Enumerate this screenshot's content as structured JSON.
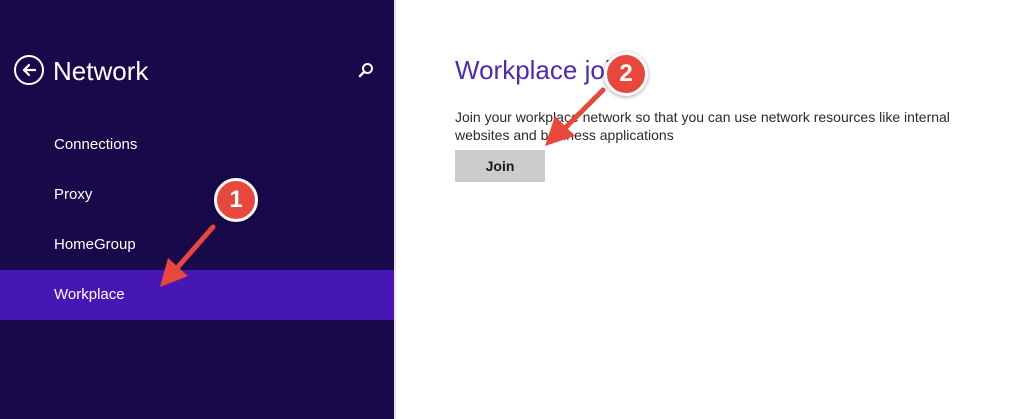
{
  "sidebar": {
    "title": "Network",
    "items": [
      {
        "label": "Connections",
        "selected": false
      },
      {
        "label": "Proxy",
        "selected": false
      },
      {
        "label": "HomeGroup",
        "selected": false
      },
      {
        "label": "Workplace",
        "selected": true
      }
    ]
  },
  "content": {
    "title": "Workplace join",
    "description": "Join your workplace network so that you can use network resources like internal websites and business applications",
    "join_label": "Join"
  },
  "annotations": {
    "step1": "1",
    "step2": "2"
  },
  "icons": {
    "back": "back-arrow-circle-icon",
    "search": "search-icon",
    "arrow": "red-arrow-icon"
  },
  "colors": {
    "sidebar_bg": "#180a4a",
    "selected_bg": "#4617b4",
    "title_accent": "#4b2bb6",
    "annotation": "#e8473c",
    "button_bg": "#cccccc"
  }
}
